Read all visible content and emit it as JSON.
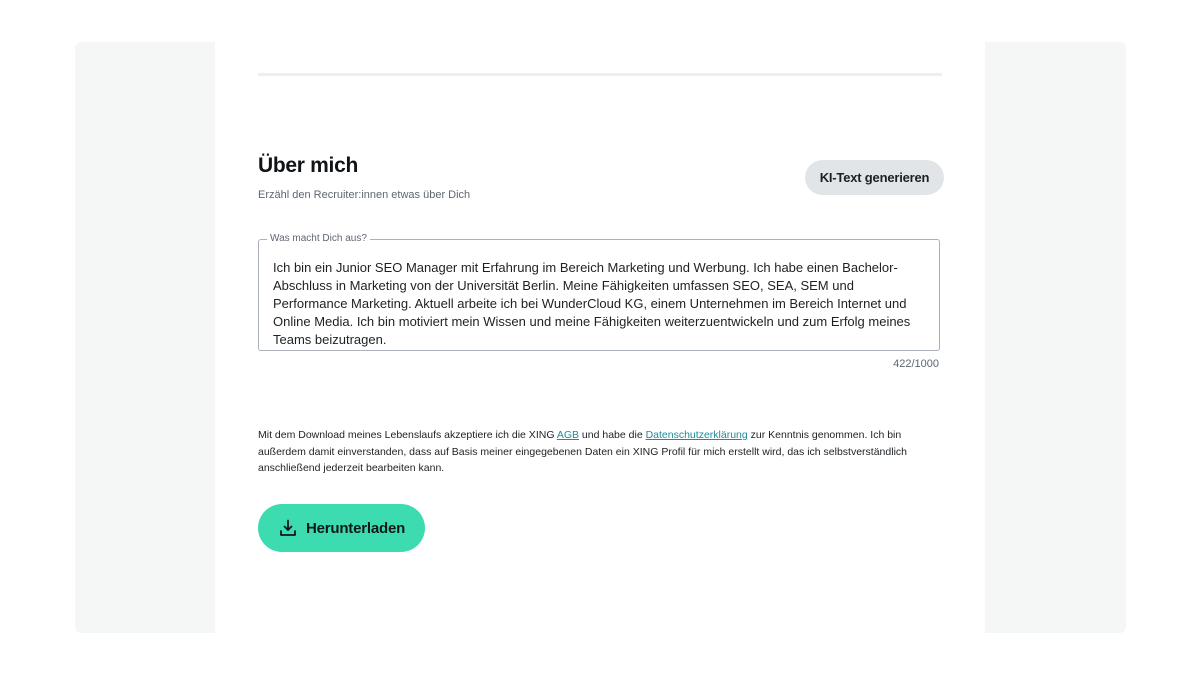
{
  "about": {
    "title": "Über mich",
    "subtitle": "Erzähl den Recruiter:innen etwas über Dich",
    "ai_button_label": "KI-Text generieren",
    "textarea": {
      "legend": "Was macht Dich aus?",
      "value": "Ich bin ein Junior SEO Manager mit Erfahrung im Bereich Marketing und Werbung. Ich habe einen Bachelor-Abschluss in Marketing von der Universität Berlin. Meine Fähigkeiten umfassen SEO, SEA, SEM und Performance Marketing. Aktuell arbeite ich bei WunderCloud KG, einem Unternehmen im Bereich Internet und Online Media. Ich bin motiviert mein Wissen und meine Fähigkeiten weiterzuentwickeln und zum Erfolg meines Teams beizutragen.",
      "counter": "422/1000"
    }
  },
  "consent": {
    "text_part1": "Mit dem Download meines Lebenslaufs akzeptiere ich die XING ",
    "agb_link": "AGB",
    "text_part2": " und habe die ",
    "privacy_link": "Datenschutzerklärung",
    "text_part3": " zur Kenntnis genommen. Ich bin außerdem damit einverstanden, dass auf Basis meiner eingegebenen Daten ein XING Profil für mich erstellt wird, das ich selbstverständlich anschließend jederzeit bearbeiten kann."
  },
  "download": {
    "label": "Herunterladen",
    "icon": "download-icon"
  },
  "colors": {
    "accent": "#3ddbb0",
    "link": "#1f8a99",
    "secondary_button": "#e2e5e7"
  }
}
